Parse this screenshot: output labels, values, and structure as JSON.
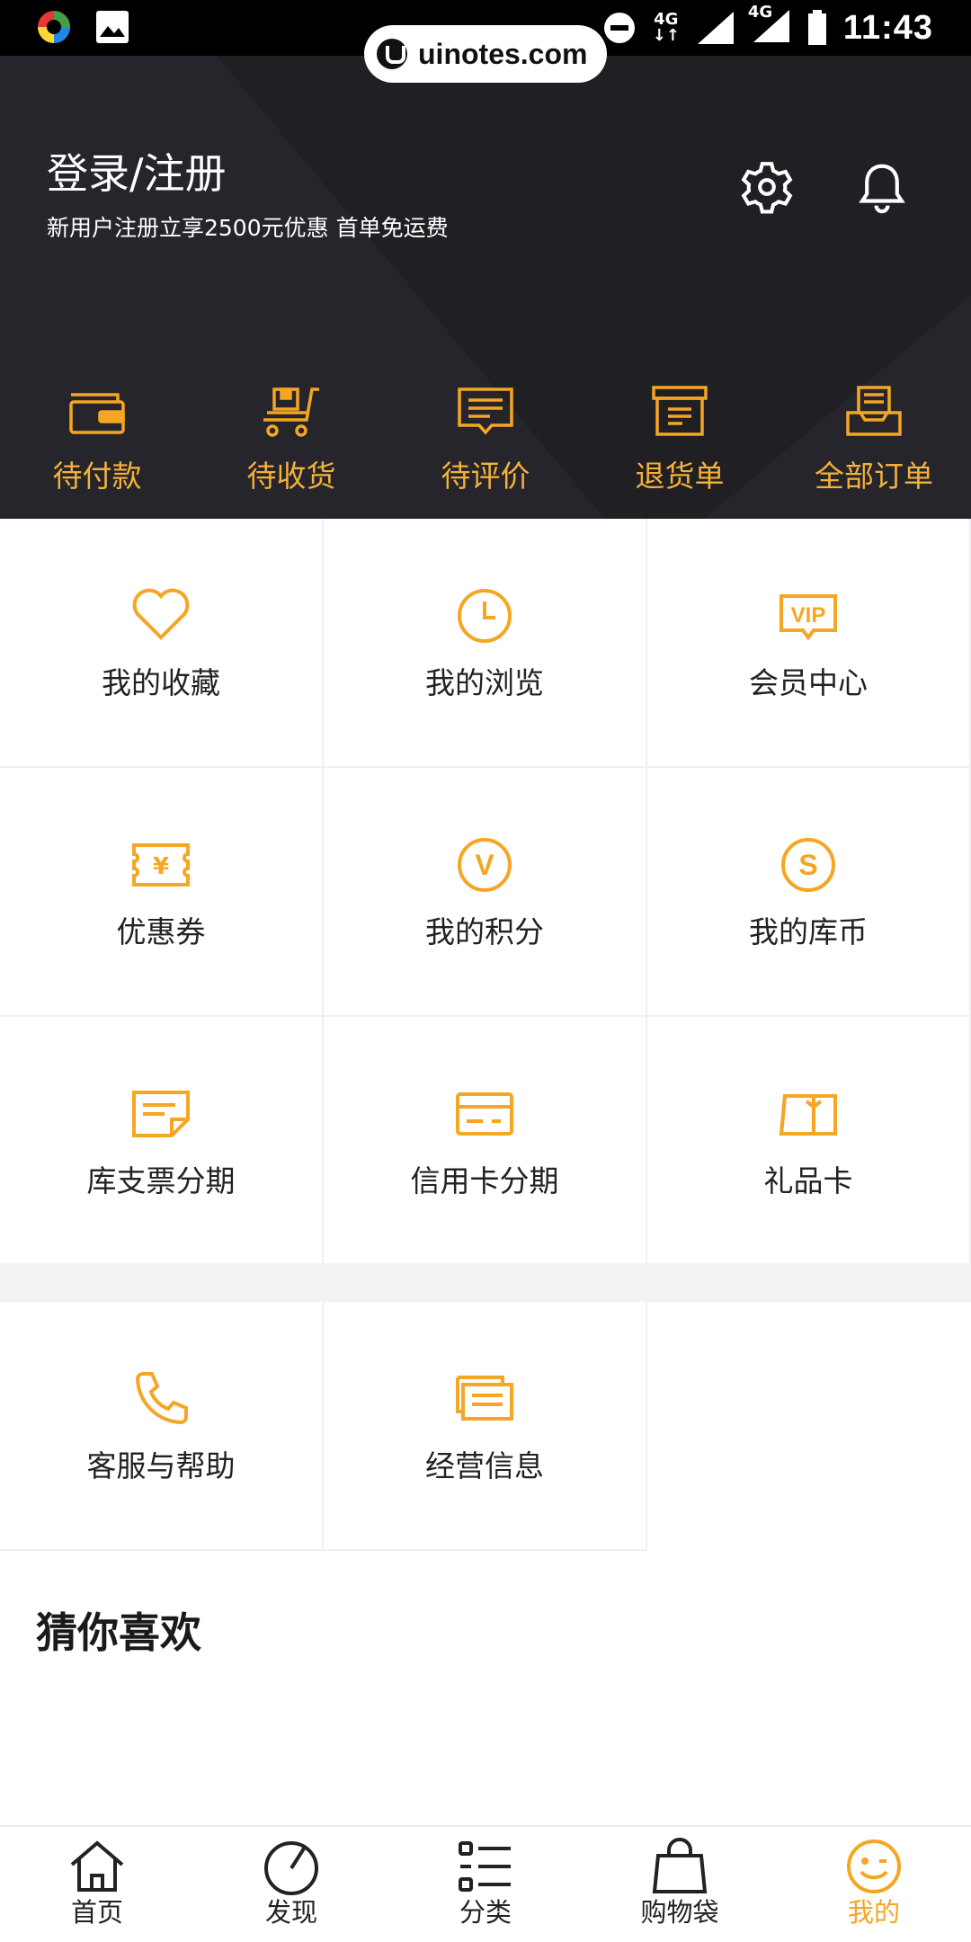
{
  "status_bar": {
    "time": "11:43",
    "network_1": "4G",
    "network_2": "4G",
    "icons": [
      "app-logo-icon",
      "image-icon",
      "do-not-disturb-icon",
      "data-arrows-icon",
      "signal-icon",
      "signal-icon",
      "battery-icon"
    ]
  },
  "watermark": {
    "text": "uinotes.com"
  },
  "header": {
    "title": "登录/注册",
    "subtitle": "新用户注册立享2500元优惠  首单免运费",
    "icons": [
      "settings-icon",
      "bell-icon"
    ]
  },
  "orders": [
    {
      "label": "待付款",
      "icon": "wallet-icon"
    },
    {
      "label": "待收货",
      "icon": "cart-icon"
    },
    {
      "label": "待评价",
      "icon": "comment-icon"
    },
    {
      "label": "退货单",
      "icon": "return-box-icon"
    },
    {
      "label": "全部订单",
      "icon": "orders-tray-icon"
    }
  ],
  "grid1": [
    {
      "label": "我的收藏",
      "icon": "heart-icon"
    },
    {
      "label": "我的浏览",
      "icon": "clock-icon"
    },
    {
      "label": "会员中心",
      "icon": "vip-icon"
    },
    {
      "label": "优惠券",
      "icon": "coupon-icon"
    },
    {
      "label": "我的积分",
      "icon": "points-icon"
    },
    {
      "label": "我的库币",
      "icon": "coin-icon"
    },
    {
      "label": "库支票分期",
      "icon": "check-installment-icon"
    },
    {
      "label": "信用卡分期",
      "icon": "credit-card-icon"
    },
    {
      "label": "礼品卡",
      "icon": "gift-card-icon"
    }
  ],
  "grid2": [
    {
      "label": "客服与帮助",
      "icon": "phone-icon"
    },
    {
      "label": "经营信息",
      "icon": "business-docs-icon"
    }
  ],
  "section_title": "猜你喜欢",
  "bottom_nav": [
    {
      "label": "首页",
      "icon": "home-icon",
      "active": false
    },
    {
      "label": "发现",
      "icon": "discover-icon",
      "active": false
    },
    {
      "label": "分类",
      "icon": "category-icon",
      "active": false
    },
    {
      "label": "购物袋",
      "icon": "bag-icon",
      "active": false
    },
    {
      "label": "我的",
      "icon": "smile-icon",
      "active": true
    }
  ],
  "colors": {
    "accent": "#f5a623",
    "header_bg": "#25252b",
    "order_label": "#f5b13a"
  }
}
